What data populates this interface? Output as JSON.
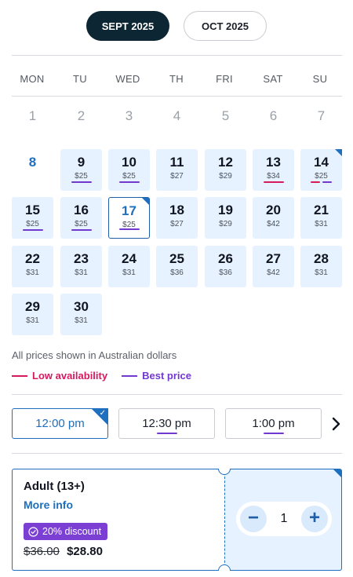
{
  "months": [
    {
      "label": "SEPT 2025",
      "active": true
    },
    {
      "label": "OCT 2025",
      "active": false
    }
  ],
  "weekdays": [
    "MON",
    "TU",
    "WED",
    "TH",
    "FRI",
    "SAT",
    "SU"
  ],
  "days": [
    {
      "n": "1",
      "state": "disabled"
    },
    {
      "n": "2",
      "state": "disabled"
    },
    {
      "n": "3",
      "state": "disabled"
    },
    {
      "n": "4",
      "state": "disabled"
    },
    {
      "n": "5",
      "state": "disabled"
    },
    {
      "n": "6",
      "state": "disabled"
    },
    {
      "n": "7",
      "state": "disabled"
    },
    {
      "n": "8",
      "state": "today"
    },
    {
      "n": "9",
      "price": "$25",
      "state": "avail",
      "tags": [
        "best"
      ]
    },
    {
      "n": "10",
      "price": "$25",
      "state": "avail",
      "tags": [
        "best"
      ]
    },
    {
      "n": "11",
      "price": "$27",
      "state": "avail",
      "tags": []
    },
    {
      "n": "12",
      "price": "$29",
      "state": "avail",
      "tags": []
    },
    {
      "n": "13",
      "price": "$34",
      "state": "avail",
      "tags": [
        "low"
      ]
    },
    {
      "n": "14",
      "price": "$25",
      "state": "avail",
      "tags": [
        "low",
        "best"
      ],
      "corner": true
    },
    {
      "n": "15",
      "price": "$25",
      "state": "avail",
      "tags": [
        "best"
      ]
    },
    {
      "n": "16",
      "price": "$25",
      "state": "avail",
      "tags": [
        "best"
      ]
    },
    {
      "n": "17",
      "price": "$25",
      "state": "selected",
      "tags": [
        "best"
      ],
      "corner": true
    },
    {
      "n": "18",
      "price": "$27",
      "state": "avail",
      "tags": []
    },
    {
      "n": "19",
      "price": "$29",
      "state": "avail",
      "tags": []
    },
    {
      "n": "20",
      "price": "$42",
      "state": "avail",
      "tags": []
    },
    {
      "n": "21",
      "price": "$31",
      "state": "avail",
      "tags": []
    },
    {
      "n": "22",
      "price": "$31",
      "state": "avail",
      "tags": []
    },
    {
      "n": "23",
      "price": "$31",
      "state": "avail",
      "tags": []
    },
    {
      "n": "24",
      "price": "$31",
      "state": "avail",
      "tags": []
    },
    {
      "n": "25",
      "price": "$36",
      "state": "avail",
      "tags": []
    },
    {
      "n": "26",
      "price": "$36",
      "state": "avail",
      "tags": []
    },
    {
      "n": "27",
      "price": "$42",
      "state": "avail",
      "tags": []
    },
    {
      "n": "28",
      "price": "$31",
      "state": "avail",
      "tags": []
    },
    {
      "n": "29",
      "price": "$31",
      "state": "avail",
      "tags": []
    },
    {
      "n": "30",
      "price": "$31",
      "state": "avail",
      "tags": []
    }
  ],
  "currency_note": "All prices shown in Australian dollars",
  "legend": {
    "low_label": "Low availability",
    "best_label": "Best price",
    "low_color": "#d61a5e",
    "best_color": "#7239d1"
  },
  "times": [
    {
      "label": "12:00 pm",
      "selected": true,
      "best": false
    },
    {
      "label": "12:30 pm",
      "selected": false,
      "best": true
    },
    {
      "label": "1:00 pm",
      "selected": false,
      "best": true
    }
  ],
  "next_icon": "chevron-right-icon",
  "ticket": {
    "name": "Adult (13+)",
    "more_info": "More info",
    "discount": "20% discount",
    "old_price": "$36.00",
    "new_price": "$28.80",
    "quantity": "1",
    "minus": "−",
    "plus": "+"
  },
  "colors": {
    "accent": "#1e6fbf",
    "dark": "#0c2733",
    "available_bg": "#e6f2ff",
    "discount_bg": "#7b3fd4"
  }
}
